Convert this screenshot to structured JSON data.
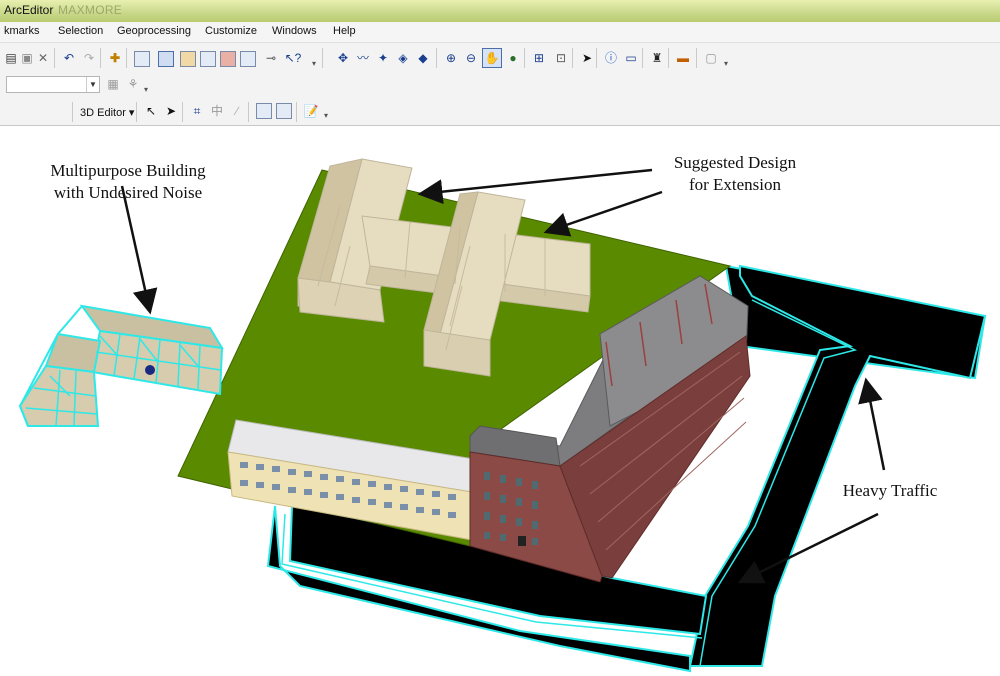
{
  "window": {
    "title": "ArcEditor",
    "ghost_title": "MAXMORE            "
  },
  "menu": {
    "items": [
      "kmarks",
      "Selection",
      "Geoprocessing",
      "Customize",
      "Windows",
      "Help"
    ]
  },
  "toolbar3": {
    "editor_label": "3D Editor ▾"
  },
  "annotations": {
    "noise_line1": "Multipurpose Building",
    "noise_line2": "with Undesired Noise",
    "design_line1": "Suggested Design",
    "design_line2": "for Extension",
    "traffic": "Heavy Traffic"
  },
  "colors": {
    "lawn": "#5a8a00",
    "road": "#000000",
    "road_outline": "#2ee8e8",
    "beige": "#e6dcc0",
    "brick": "#8b4a46",
    "roof": "#7d7d80",
    "cyan": "#7fe9ef"
  },
  "icons": [
    "undo-icon",
    "redo-icon",
    "add-data-icon",
    "zoom-in-icon",
    "zoom-out-icon",
    "pan-icon",
    "globe-icon",
    "select-arrow-icon",
    "identify-icon",
    "find-icon",
    "measure-icon"
  ]
}
